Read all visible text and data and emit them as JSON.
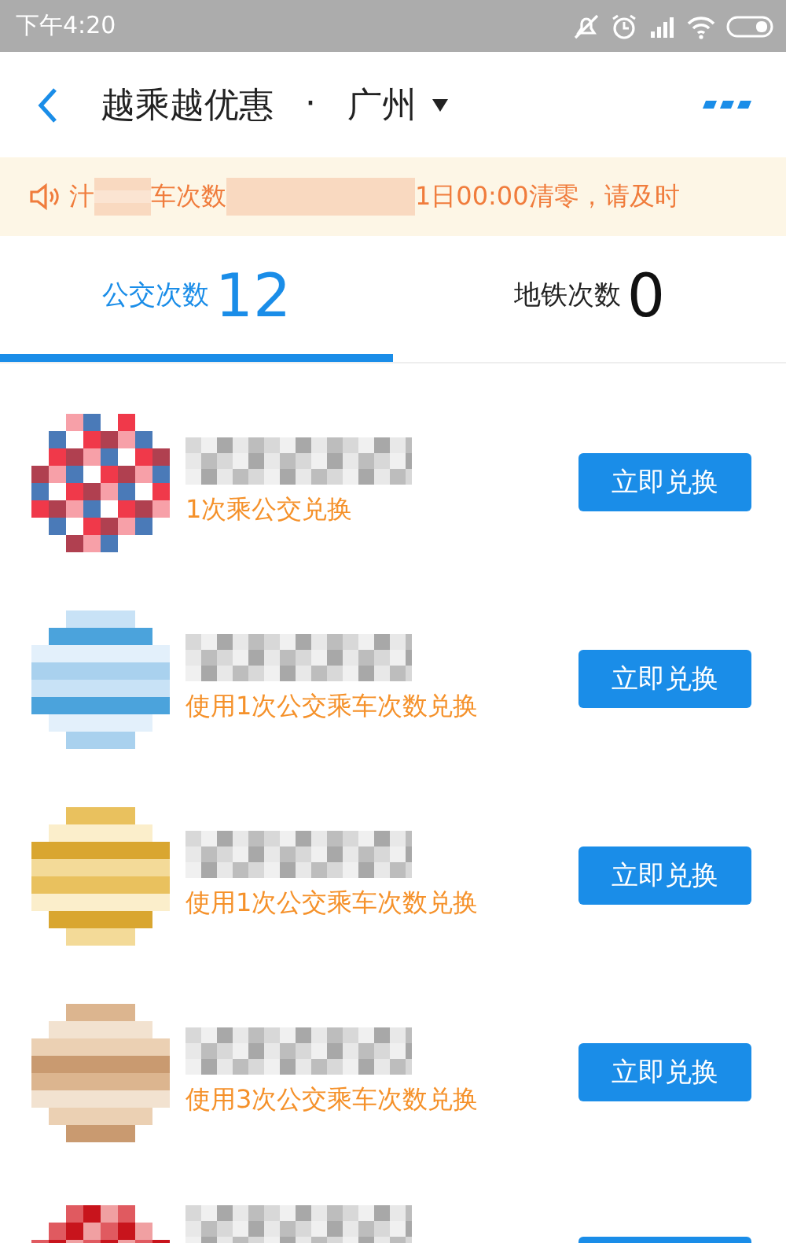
{
  "status_bar": {
    "time": "下午4:20"
  },
  "header": {
    "title": "越乘越优惠",
    "separator": "·",
    "city": "广州"
  },
  "notice": {
    "parts": [
      {
        "kind": "text",
        "text": "汁"
      },
      {
        "kind": "blur"
      },
      {
        "kind": "text",
        "text": "车次数"
      },
      {
        "kind": "blur"
      },
      {
        "kind": "text",
        "text": "1日00:00清零，请及时"
      }
    ]
  },
  "tabs": [
    {
      "label": "公交次数",
      "count": "12",
      "selected": true
    },
    {
      "label": "地铁次数",
      "count": "0",
      "selected": false
    }
  ],
  "rows": [
    {
      "kind": "full",
      "subtitle": "1次乘公交兑换",
      "button": "立即兑换"
    },
    {
      "kind": "full",
      "subtitle": "使用1次公交乘车次数兑换",
      "button": "立即兑换"
    },
    {
      "kind": "full",
      "subtitle": "使用1次公交乘车次数兑换",
      "button": "立即兑换"
    },
    {
      "kind": "full",
      "subtitle": "使用3次公交乘车次数兑换",
      "button": "立即兑换"
    },
    {
      "kind": "partial"
    }
  ]
}
